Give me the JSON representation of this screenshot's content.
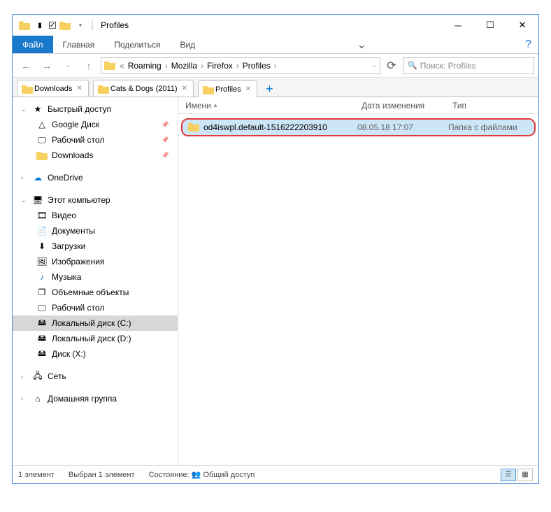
{
  "title": "Profiles",
  "menu": {
    "file": "Файл",
    "home": "Главная",
    "share": "Поделиться",
    "view": "Вид"
  },
  "breadcrumb": [
    "Roaming",
    "Mozilla",
    "Firefox",
    "Profiles"
  ],
  "search_placeholder": "Поиск: Profiles",
  "folder_tabs": [
    {
      "label": "Downloads"
    },
    {
      "label": "Cats & Dogs (2011)"
    },
    {
      "label": "Profiles",
      "active": true
    }
  ],
  "columns": {
    "name": "Имени",
    "date": "Дата изменения",
    "type": "Тип"
  },
  "rows": [
    {
      "name": "od4iswpl.default-1516222203910",
      "date": "08.05.18 17:07",
      "type": "Папка с файлами"
    }
  ],
  "sidebar": {
    "quick": "Быстрый доступ",
    "quick_items": [
      "Google Диск",
      "Рабочий стол",
      "Downloads"
    ],
    "onedrive": "OneDrive",
    "thispc": "Этот компьютер",
    "pc_items": [
      "Видео",
      "Документы",
      "Загрузки",
      "Изображения",
      "Музыка",
      "Объемные объекты",
      "Рабочий стол",
      "Локальный диск (C:)",
      "Локальный диск (D:)",
      "Диск (X:)"
    ],
    "network": "Сеть",
    "homegroup": "Домашняя группа"
  },
  "status": {
    "count": "1 элемент",
    "selected": "Выбран 1 элемент",
    "state_label": "Состояние:",
    "shared": "Общий доступ"
  }
}
